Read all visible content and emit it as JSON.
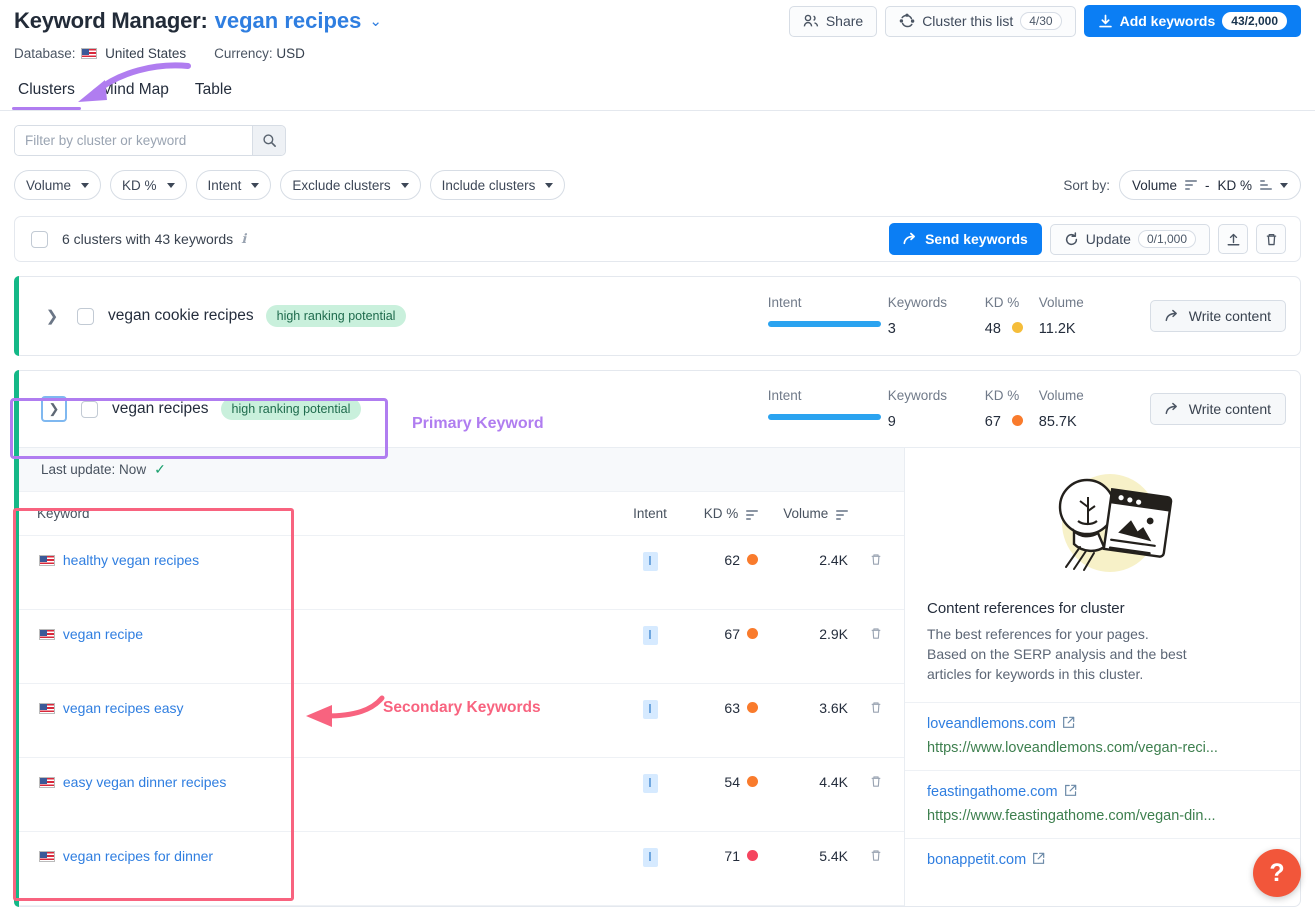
{
  "header": {
    "title_prefix": "Keyword Manager:",
    "title_keyword": "vegan recipes",
    "caret": "⌄",
    "database_label": "Database:",
    "database_value": "United States",
    "currency_label": "Currency:",
    "currency_value": "USD",
    "actions": {
      "share": "Share",
      "cluster_list": "Cluster this list",
      "cluster_list_count": "4/30",
      "add_keywords": "Add keywords",
      "add_keywords_count": "43/2,000"
    },
    "tabs": [
      {
        "label": "Clusters",
        "active": true
      },
      {
        "label": "Mind Map",
        "active": false
      },
      {
        "label": "Table",
        "active": false
      }
    ]
  },
  "filters": {
    "search_placeholder": "Filter by cluster or keyword",
    "search_value": "",
    "chips": [
      "Volume",
      "KD %",
      "Intent",
      "Exclude clusters",
      "Include clusters"
    ],
    "sort_label": "Sort by:",
    "sort_value_a": "Volume",
    "sort_sep": "-",
    "sort_value_b": "KD %"
  },
  "toolbar": {
    "summary": "6 clusters with 43 keywords",
    "send_keywords": "Send keywords",
    "update": "Update",
    "update_count": "0/1,000"
  },
  "clusters": [
    {
      "name": "vegan cookie recipes",
      "badge": "high ranking potential",
      "expanded": false,
      "labels": {
        "intent": "Intent",
        "keywords": "Keywords",
        "kd": "KD %",
        "volume": "Volume"
      },
      "keywords": "3",
      "kd": "48",
      "kd_color": "#f5bd3a",
      "volume": "11.2K",
      "write_content": "Write content"
    },
    {
      "name": "vegan recipes",
      "badge": "high ranking potential",
      "expanded": true,
      "labels": {
        "intent": "Intent",
        "keywords": "Keywords",
        "kd": "KD %",
        "volume": "Volume"
      },
      "keywords": "9",
      "kd": "67",
      "kd_color": "#f97b2c",
      "volume": "85.7K",
      "write_content": "Write content"
    }
  ],
  "expanded_panel": {
    "last_update_label": "Last update: Now",
    "table_headers": {
      "keyword": "Keyword",
      "intent": "Intent",
      "kd": "KD %",
      "volume": "Volume"
    },
    "rows": [
      {
        "keyword": "healthy vegan recipes",
        "intent": "I",
        "kd": "62",
        "kd_color": "#f97b2c",
        "volume": "2.4K"
      },
      {
        "keyword": "vegan recipe",
        "intent": "I",
        "kd": "67",
        "kd_color": "#f97b2c",
        "volume": "2.9K"
      },
      {
        "keyword": "vegan recipes easy",
        "intent": "I",
        "kd": "63",
        "kd_color": "#f97b2c",
        "volume": "3.6K"
      },
      {
        "keyword": "easy vegan dinner recipes",
        "intent": "I",
        "kd": "54",
        "kd_color": "#f97b2c",
        "volume": "4.4K"
      },
      {
        "keyword": "vegan recipes for dinner",
        "intent": "I",
        "kd": "71",
        "kd_color": "#f5455f",
        "volume": "5.4K"
      }
    ],
    "references": {
      "title": "Content references for cluster",
      "subtitle_line1": "The best references for your pages.",
      "subtitle_line2": "Based on the SERP analysis and the best",
      "subtitle_line3": "articles for keywords in this cluster.",
      "items": [
        {
          "domain": "loveandlemons.com",
          "url": "https://www.loveandlemons.com/vegan-reci..."
        },
        {
          "domain": "feastingathome.com",
          "url": "https://www.feastingathome.com/vegan-din..."
        },
        {
          "domain": "bonappetit.com",
          "url": ""
        }
      ]
    }
  },
  "annotations": {
    "primary_keyword": "Primary Keyword",
    "secondary_keywords": "Secondary Keywords",
    "purple": "#b07df0",
    "pink": "#f8637f"
  },
  "help": {
    "glyph": "?"
  }
}
